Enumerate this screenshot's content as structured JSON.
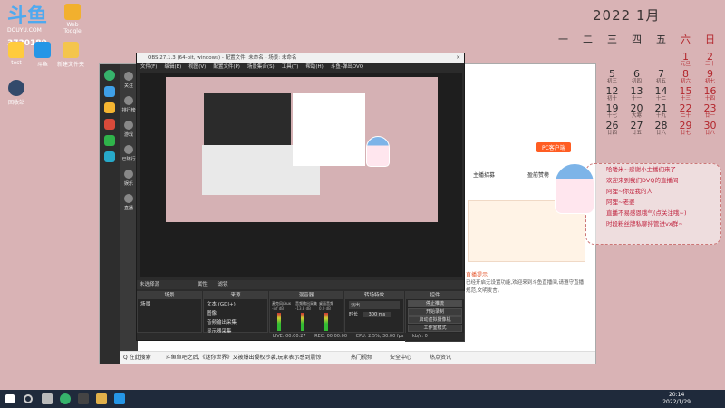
{
  "desktop": {
    "logo_text": "斗鱼",
    "logo_sub": "DOUYU.COM",
    "room_id": "3730189",
    "icons": [
      {
        "label": "Web Toggle",
        "color": "#f2b02e"
      },
      {
        "label": "test",
        "color": "#ffcb3d"
      },
      {
        "label": "斗鱼",
        "color": "#2596e6"
      },
      {
        "label": "新建文件夹",
        "color": "#f4c54c"
      },
      {
        "label": "回收站",
        "color": "#334a6b"
      }
    ]
  },
  "calendar": {
    "title": "2022 1月",
    "weekdays": [
      "一",
      "二",
      "三",
      "四",
      "五",
      "六",
      "日"
    ],
    "weeks": [
      [
        {
          "d": "",
          "l": ""
        },
        {
          "d": "",
          "l": ""
        },
        {
          "d": "",
          "l": ""
        },
        {
          "d": "",
          "l": ""
        },
        {
          "d": "",
          "l": ""
        },
        {
          "d": "1",
          "l": "元旦",
          "red": true
        },
        {
          "d": "2",
          "l": "三十",
          "red": true
        }
      ],
      [
        {
          "d": "3",
          "l": "初一"
        },
        {
          "d": "4",
          "l": "初二"
        },
        {
          "d": "5",
          "l": "初三"
        },
        {
          "d": "6",
          "l": "初四"
        },
        {
          "d": "7",
          "l": "初五"
        },
        {
          "d": "8",
          "l": "初六",
          "red": true
        },
        {
          "d": "9",
          "l": "初七",
          "red": true
        }
      ],
      [
        {
          "d": "10",
          "l": "初八"
        },
        {
          "d": "11",
          "l": "初九"
        },
        {
          "d": "12",
          "l": "初十"
        },
        {
          "d": "13",
          "l": "十一"
        },
        {
          "d": "14",
          "l": "十二"
        },
        {
          "d": "15",
          "l": "十三",
          "red": true
        },
        {
          "d": "16",
          "l": "十四",
          "red": true
        }
      ],
      [
        {
          "d": "17",
          "l": "十五"
        },
        {
          "d": "18",
          "l": "十六"
        },
        {
          "d": "19",
          "l": "十七"
        },
        {
          "d": "20",
          "l": "大寒"
        },
        {
          "d": "21",
          "l": "十九"
        },
        {
          "d": "22",
          "l": "二十",
          "red": true
        },
        {
          "d": "23",
          "l": "廿一",
          "red": true
        }
      ],
      [
        {
          "d": "24",
          "l": "廿二"
        },
        {
          "d": "25",
          "l": "廿三"
        },
        {
          "d": "26",
          "l": "廿四"
        },
        {
          "d": "27",
          "l": "廿五"
        },
        {
          "d": "28",
          "l": "廿六"
        },
        {
          "d": "29",
          "l": "廿七",
          "red": true
        },
        {
          "d": "30",
          "l": "廿八",
          "red": true
        }
      ],
      [
        {
          "d": "31",
          "l": "廿九"
        },
        {
          "d": "",
          "l": ""
        },
        {
          "d": "",
          "l": ""
        },
        {
          "d": "",
          "l": ""
        },
        {
          "d": "",
          "l": ""
        },
        {
          "d": "",
          "l": ""
        },
        {
          "d": "",
          "l": ""
        }
      ]
    ]
  },
  "browser": {
    "sidebar": [
      "关注",
      "排行榜",
      "游戏",
      "已随行",
      "娱乐",
      "直播"
    ],
    "status_left": "Q 在此搜索",
    "news_text": "斗鱼鱼吧之后,《迷你世界》又被爆出侵权抄袭,玩家表示感到震惊",
    "status_items": [
      "热门视频",
      "安全中心",
      "热点资讯"
    ],
    "page_label": "PC客户端",
    "anchor_label": "主播招募",
    "rank_label": "盈前赞榜",
    "notice_title": "直播提示",
    "notice_text": "已经开启无设置功能,欢迎来到斗鱼直播间,请遵守直播规范,文明发言。"
  },
  "obs": {
    "title": "OBS 27.1.3 (64-bit, windows) - 配置文件: 未命名 - 场景: 未命名",
    "menu": [
      "文件(F)",
      "编辑(E)",
      "视图(V)",
      "配置文件(P)",
      "场景集合(S)",
      "工具(T)",
      "帮助(H)",
      "斗鱼-弹出OVQ"
    ],
    "scene_bar": "未选择源",
    "bar_actions": [
      "属性",
      "滤镜"
    ],
    "docks": {
      "scenes": {
        "title": "场景",
        "items": [
          "场景"
        ]
      },
      "sources": {
        "title": "来源",
        "items": [
          "文本 (GDI+)",
          "图像",
          "音频输出采集",
          "显示器采集"
        ]
      },
      "mixer": {
        "title": "混音器",
        "channels": [
          "麦克风/Aux",
          "音频输出采集",
          "桌面音频"
        ],
        "levels": [
          "-inf dB",
          "-13.8 dB",
          "0.0 dB"
        ]
      },
      "transitions": {
        "title": "转场特效",
        "type": "淡出",
        "duration_label": "时长",
        "duration": "300 ms"
      },
      "controls": {
        "title": "控件",
        "buttons": [
          "停止推流",
          "开始录制",
          "启动虚拟摄像机",
          "工作室模式",
          "设置",
          "退出"
        ]
      }
    },
    "status": {
      "live": "LIVE: 00:00:27",
      "rec": "REC: 00:00:00",
      "cpu": "CPU: 2.5%, 30.00 fps",
      "bitrate": "kb/s: 0"
    }
  },
  "overlay": {
    "lines": [
      "哈喽米~感谢小主播们来了",
      "欢迎来到我们DVQ的直播间",
      "阿狸~你是我的人",
      "阿狸~老婆",
      "直播不易感恩哦气(点关注哦~)",
      "时段粉丝牌私聊排管进vx群~"
    ]
  },
  "taskbar": {
    "time": "20:14",
    "date": "2022/1/29"
  }
}
